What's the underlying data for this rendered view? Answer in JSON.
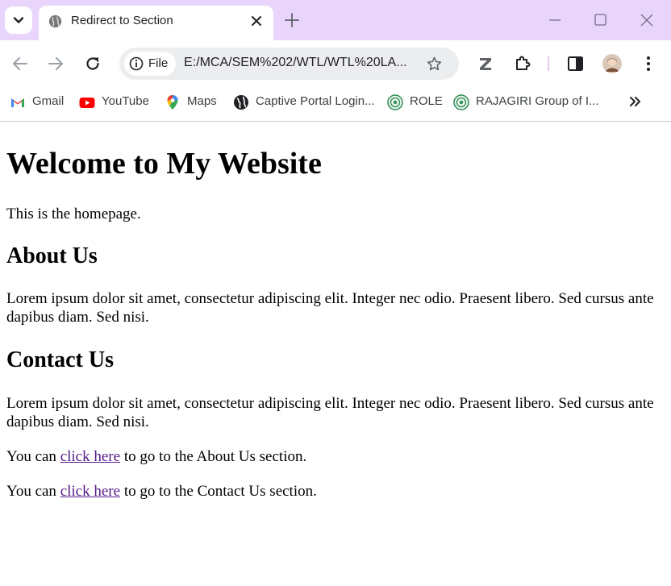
{
  "tab": {
    "title": "Redirect to Section"
  },
  "toolbar": {
    "site_chip_label": "File",
    "url": "E:/MCA/SEM%202/WTL/WTL%20LA..."
  },
  "bookmarks": [
    {
      "label": "Gmail",
      "icon": "gmail-icon"
    },
    {
      "label": "YouTube",
      "icon": "youtube-icon"
    },
    {
      "label": "Maps",
      "icon": "maps-icon"
    },
    {
      "label": "Captive Portal Login...",
      "icon": "globe-icon"
    },
    {
      "label": "ROLE",
      "icon": "role-icon"
    },
    {
      "label": "RAJAGIRI Group of I...",
      "icon": "rajagiri-icon"
    }
  ],
  "page": {
    "heading": "Welcome to My Website",
    "intro": "This is the homepage.",
    "about_heading": "About Us",
    "about_text": "Lorem ipsum dolor sit amet, consectetur adipiscing elit. Integer nec odio. Praesent libero. Sed cursus ante dapibus diam. Sed nisi.",
    "contact_heading": "Contact Us",
    "contact_text": "Lorem ipsum dolor sit amet, consectetur adipiscing elit. Integer nec odio. Praesent libero. Sed cursus ante dapibus diam. Sed nisi.",
    "about_link": {
      "prefix": "You can ",
      "link": "click here",
      "suffix": " to go to the About Us section."
    },
    "contact_link": {
      "prefix": "You can ",
      "link": "click here",
      "suffix": " to go to the Contact Us section."
    }
  },
  "colors": {
    "tabstrip": "#e9d5fb",
    "visited_link": "#551a8b",
    "omnibox": "#ecedef"
  }
}
